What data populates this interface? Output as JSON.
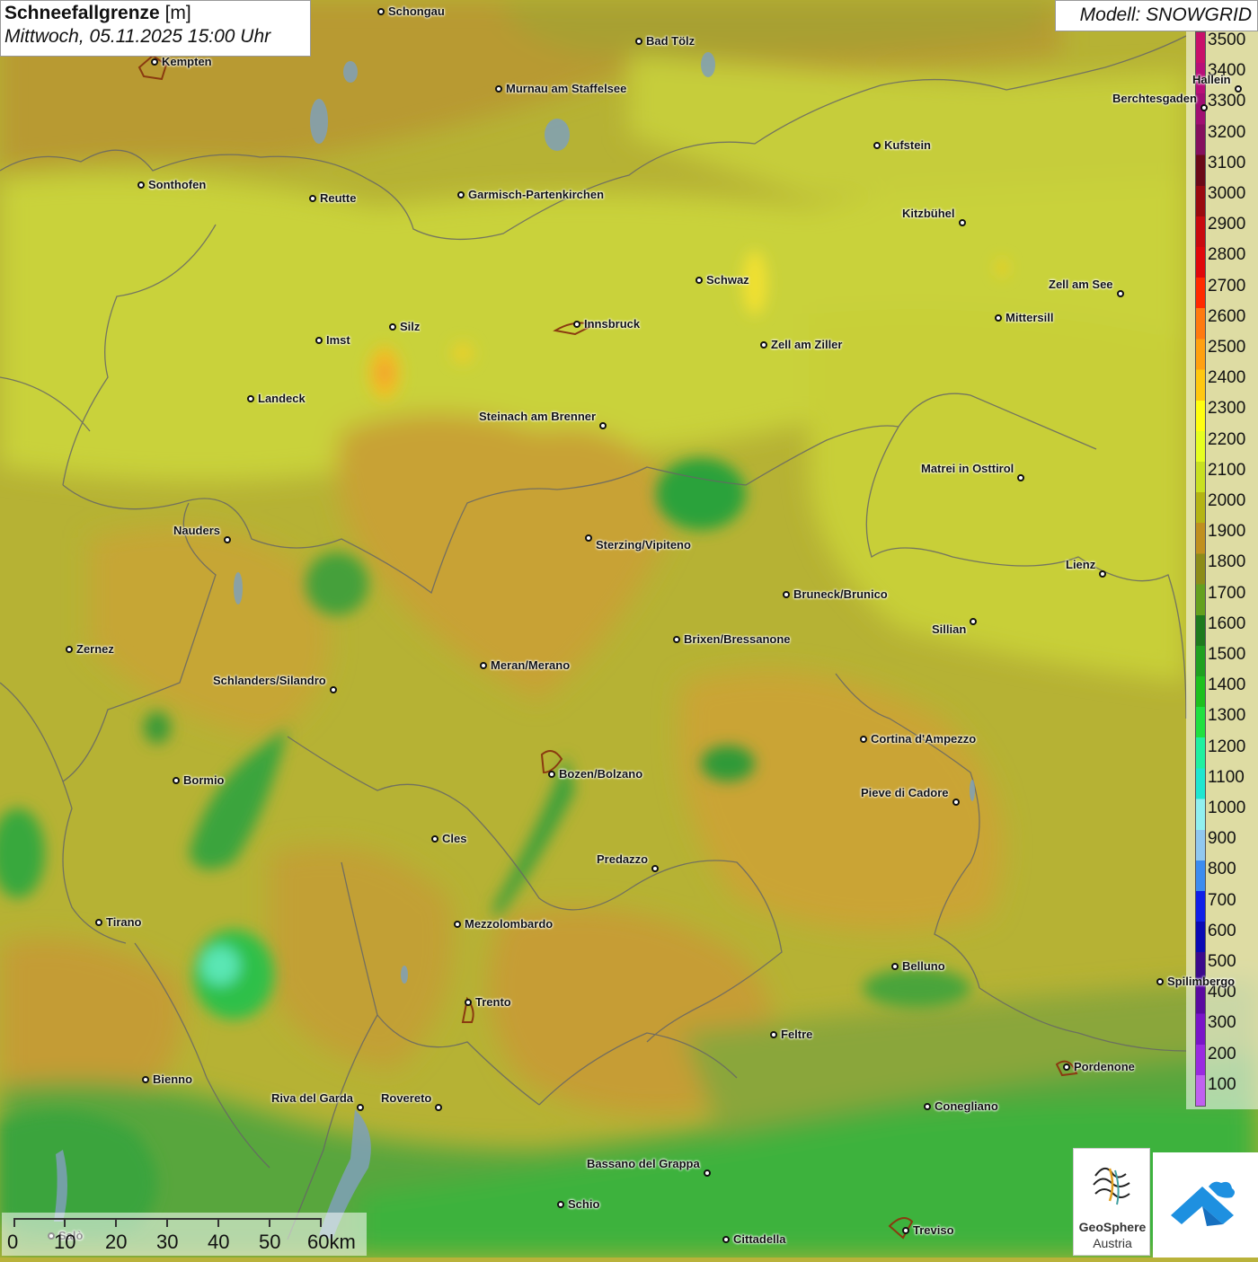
{
  "title": {
    "label": "Schneefallgrenze",
    "unit": "[m]",
    "datetime": "Mittwoch, 05.11.2025 15:00 Uhr"
  },
  "model": "Modell: SNOWGRID",
  "legend": {
    "labels": [
      "3500",
      "3400",
      "3300",
      "3200",
      "3100",
      "3000",
      "2900",
      "2800",
      "2700",
      "2600",
      "2500",
      "2400",
      "2300",
      "2200",
      "2100",
      "2000",
      "1900",
      "1800",
      "1700",
      "1600",
      "1500",
      "1400",
      "1300",
      "1200",
      "1100",
      "1000",
      "900",
      "800",
      "700",
      "600",
      "500",
      "400",
      "300",
      "200",
      "100"
    ],
    "colors": [
      "#c8106a",
      "#b80f78",
      "#a00f72",
      "#85105e",
      "#6b0a18",
      "#9a0a10",
      "#c80a10",
      "#e0080c",
      "#ff2a00",
      "#ff7a10",
      "#ffa010",
      "#ffc810",
      "#ffff10",
      "#e6ff20",
      "#c8e020",
      "#b4b414",
      "#c0901e",
      "#8c8c18",
      "#64a01e",
      "#1e7a1e",
      "#20a020",
      "#1ec01e",
      "#20e040",
      "#20f0a0",
      "#20e6d0",
      "#90f0f0",
      "#90c8f0",
      "#3c8cf0",
      "#1020e8",
      "#0a0ab4",
      "#3c0a8c",
      "#5a0aa0",
      "#7a14c8",
      "#9a2ae0",
      "#c060f0"
    ]
  },
  "cities": [
    {
      "name": "Schongau"
    },
    {
      "name": "Bad Tölz"
    },
    {
      "name": "Kempten"
    },
    {
      "name": "Murnau am Staffelsee"
    },
    {
      "name": "Berchtesgaden"
    },
    {
      "name": "Kufstein"
    },
    {
      "name": "Sonthofen"
    },
    {
      "name": "Reutte"
    },
    {
      "name": "Garmisch-Partenkirchen"
    },
    {
      "name": "Kitzbühel"
    },
    {
      "name": "Schwaz"
    },
    {
      "name": "Zell am See"
    },
    {
      "name": "Mittersill"
    },
    {
      "name": "Innsbruck"
    },
    {
      "name": "Zell am Ziller"
    },
    {
      "name": "Imst"
    },
    {
      "name": "Silz"
    },
    {
      "name": "Landeck"
    },
    {
      "name": "Steinach am Brenner"
    },
    {
      "name": "Matrei in Osttirol"
    },
    {
      "name": "Nauders"
    },
    {
      "name": "Sterzing/Vipiteno"
    },
    {
      "name": "Lienz"
    },
    {
      "name": "Bruneck/Brunico"
    },
    {
      "name": "Sillian"
    },
    {
      "name": "Zernez"
    },
    {
      "name": "Brixen/Bressanone"
    },
    {
      "name": "Meran/Merano"
    },
    {
      "name": "Schlanders/Silandro"
    },
    {
      "name": "Cortina d'Ampezzo"
    },
    {
      "name": "Bormio"
    },
    {
      "name": "Bozen/Bolzano"
    },
    {
      "name": "Pieve di Cadore"
    },
    {
      "name": "Cles"
    },
    {
      "name": "Predazzo"
    },
    {
      "name": "Tirano"
    },
    {
      "name": "Mezzolombardo"
    },
    {
      "name": "Belluno"
    },
    {
      "name": "Spilimbergo"
    },
    {
      "name": "Trento"
    },
    {
      "name": "Feltre"
    },
    {
      "name": "Pordenone"
    },
    {
      "name": "Bienno"
    },
    {
      "name": "Riva del Garda"
    },
    {
      "name": "Rovereto"
    },
    {
      "name": "Conegliano"
    },
    {
      "name": "Bassano del Grappa"
    },
    {
      "name": "Schio"
    },
    {
      "name": "Treviso"
    },
    {
      "name": "Cittadella"
    },
    {
      "name": "Hallein"
    },
    {
      "name": "Salò"
    }
  ],
  "scale": {
    "labels": [
      "0",
      "10",
      "20",
      "30",
      "40",
      "50",
      "60km"
    ]
  },
  "logos": {
    "geosphere_name": "GeoSphere",
    "geosphere_sub": "Austria"
  }
}
